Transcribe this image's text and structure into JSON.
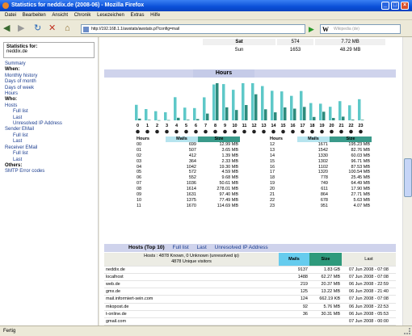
{
  "window": {
    "title": "Statistics for neddix.de (2008-06) - Mozilla Firefox"
  },
  "menu": [
    "Datei",
    "Bearbeiten",
    "Ansicht",
    "Chronik",
    "Lesezeichen",
    "Extras",
    "Hilfe"
  ],
  "nav": {
    "url": "http://192.168.1.1/awstats/awstats.pl?config=mail",
    "search_placeholder": "Wikipedia (de)"
  },
  "sidebar": {
    "stats_for_label": "Statistics for:",
    "domain": "neddix.de",
    "items": [
      {
        "text": "Summary",
        "kind": "l",
        "indent": 0
      },
      {
        "text": "When:",
        "kind": "h",
        "indent": 0
      },
      {
        "text": "Monthly history",
        "kind": "l",
        "indent": 0
      },
      {
        "text": "Days of month",
        "kind": "l",
        "indent": 0
      },
      {
        "text": "Days of week",
        "kind": "l",
        "indent": 0
      },
      {
        "text": "Hours",
        "kind": "l",
        "indent": 0
      },
      {
        "text": "Who:",
        "kind": "h",
        "indent": 0
      },
      {
        "text": "Hosts",
        "kind": "l",
        "indent": 0
      },
      {
        "text": "Full list",
        "kind": "l",
        "indent": 2
      },
      {
        "text": "Last",
        "kind": "l",
        "indent": 2
      },
      {
        "text": "Unresolved IP Address",
        "kind": "l",
        "indent": 2
      },
      {
        "text": "Sender EMail",
        "kind": "l",
        "indent": 0
      },
      {
        "text": "Full list",
        "kind": "l",
        "indent": 2
      },
      {
        "text": "Last",
        "kind": "l",
        "indent": 2
      },
      {
        "text": "Receiver EMail",
        "kind": "l",
        "indent": 0
      },
      {
        "text": "Full list",
        "kind": "l",
        "indent": 2
      },
      {
        "text": "Last",
        "kind": "l",
        "indent": 2
      },
      {
        "text": "Others:",
        "kind": "h",
        "indent": 0
      },
      {
        "text": "SMTP Error codes",
        "kind": "l",
        "indent": 0
      }
    ]
  },
  "days_partial": [
    {
      "day": "Sat",
      "mails": "574",
      "size": "7.72 MB"
    },
    {
      "day": "Sun",
      "mails": "1653",
      "size": "48.29 MB"
    }
  ],
  "hours_section": {
    "title": "Hours",
    "col_hours": "Hours",
    "col_mails": "Mails",
    "col_size": "Size"
  },
  "chart_data": {
    "type": "bar",
    "categories": [
      "0",
      "1",
      "2",
      "3",
      "4",
      "5",
      "6",
      "7",
      "8",
      "9",
      "10",
      "11",
      "12",
      "13",
      "14",
      "15",
      "16",
      "17",
      "18",
      "19",
      "20",
      "21",
      "22",
      "23"
    ],
    "series": [
      {
        "name": "Mails",
        "color": "#5ec8c8",
        "values": [
          699,
          507,
          412,
          364,
          1042,
          572,
          552,
          1036,
          1614,
          1631,
          1375,
          1670,
          1671,
          1542,
          1330,
          1302,
          1102,
          1320,
          778,
          749,
          611,
          864,
          678,
          951
        ]
      },
      {
        "name": "Size",
        "color": "#2e8b7c",
        "values": [
          12.99,
          3.65,
          1.39,
          2.33,
          19.3,
          4.59,
          9.68,
          50.61,
          278.01,
          97.4,
          77.49,
          114.69,
          195.23,
          82.76,
          60.03,
          96.71,
          87.53,
          100.54,
          25.45,
          64.49,
          17.9,
          27.71,
          5.63,
          4.07
        ]
      }
    ]
  },
  "hours_rows": [
    [
      "00",
      "699",
      "12.99 MB"
    ],
    [
      "01",
      "507",
      "3.65 MB"
    ],
    [
      "02",
      "412",
      "1.39 MB"
    ],
    [
      "03",
      "364",
      "2.33 MB"
    ],
    [
      "04",
      "1042",
      "19.30 MB"
    ],
    [
      "05",
      "572",
      "4.59 MB"
    ],
    [
      "06",
      "552",
      "9.68 MB"
    ],
    [
      "07",
      "1036",
      "50.61 MB"
    ],
    [
      "08",
      "1614",
      "278.01 MB"
    ],
    [
      "09",
      "1631",
      "97.40 MB"
    ],
    [
      "10",
      "1375",
      "77.49 MB"
    ],
    [
      "11",
      "1670",
      "114.69 MB"
    ],
    [
      "12",
      "1671",
      "195.23 MB"
    ],
    [
      "13",
      "1542",
      "82.76 MB"
    ],
    [
      "14",
      "1330",
      "60.03 MB"
    ],
    [
      "15",
      "1302",
      "96.71 MB"
    ],
    [
      "16",
      "1102",
      "87.53 MB"
    ],
    [
      "17",
      "1320",
      "100.54 MB"
    ],
    [
      "18",
      "778",
      "25.45 MB"
    ],
    [
      "19",
      "749",
      "64.49 MB"
    ],
    [
      "20",
      "611",
      "17.90 MB"
    ],
    [
      "21",
      "864",
      "27.71 MB"
    ],
    [
      "22",
      "678",
      "5.63 MB"
    ],
    [
      "23",
      "951",
      "4.07 MB"
    ]
  ],
  "hosts": {
    "title": "Hosts (Top 10)",
    "links": [
      "Full list",
      "Last",
      "Unresolved IP Address"
    ],
    "summary1": "Hosts : 4878 Known, 0 Unknown (unresolved ip)",
    "summary2": "4878 Unique visitors",
    "col_mails": "Mails",
    "col_size": "Size",
    "col_last": "Last",
    "rows": [
      [
        "neddix.de",
        "9137",
        "1.83 GB",
        "07 Jun 2008 - 07:08"
      ],
      [
        "localhost",
        "1488",
        "62.27 MB",
        "07 Jun 2008 - 07:08"
      ],
      [
        "web.de",
        "219",
        "20.37 MB",
        "06 Jun 2008 - 22:59"
      ],
      [
        "gmx.de",
        "125",
        "13.22 MB",
        "06 Jun 2008 - 21:40"
      ],
      [
        "mail.informiert-sein.com",
        "124",
        "662.19 KB",
        "07 Jun 2008 - 07:08"
      ],
      [
        "mkopost.de",
        "92",
        "5.76 MB",
        "06 Jun 2008 - 22:53"
      ],
      [
        "t-online.de",
        "36",
        "30.31 MB",
        "06 Jun 2008 - 05:53"
      ],
      [
        "gmail.com",
        "",
        "",
        "07 Jun 2008 - 00:00"
      ]
    ]
  },
  "status": "Fertig"
}
